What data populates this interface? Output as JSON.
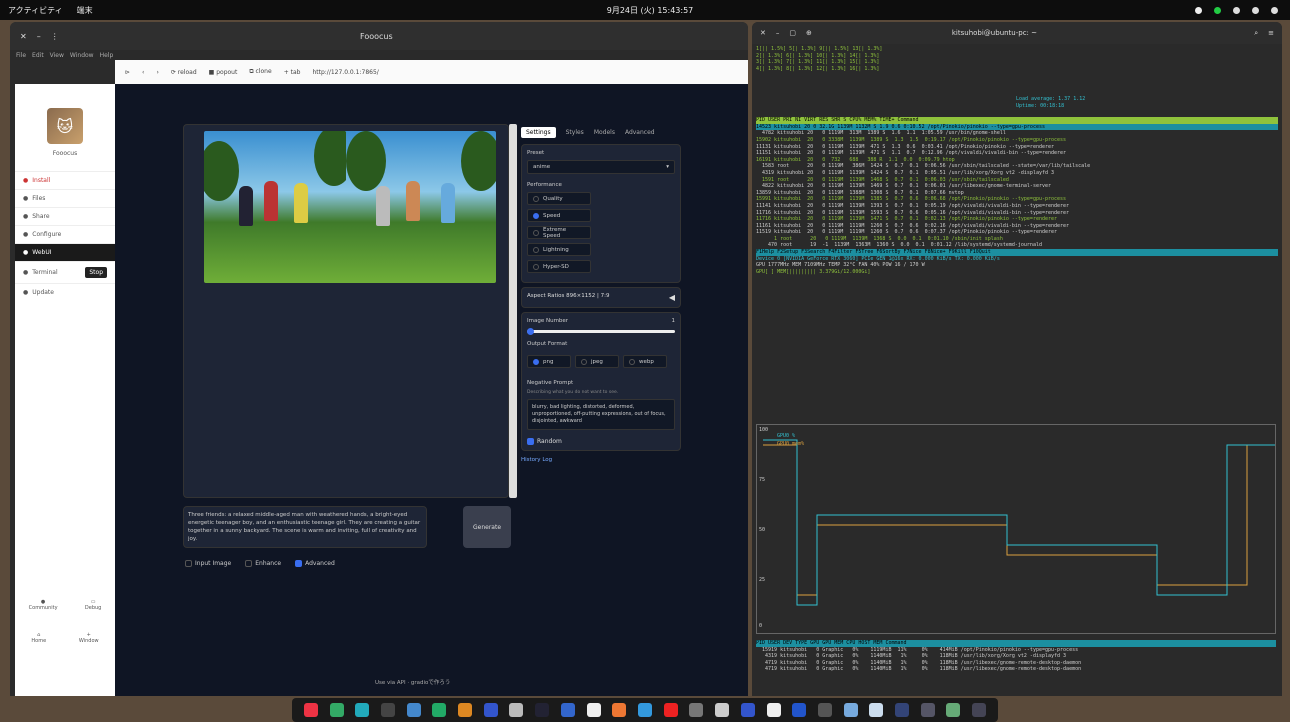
{
  "topbar": {
    "activities": "アクティビティ",
    "app": "端末",
    "clock": "9月24日 (火) 15:43:57"
  },
  "left_window": {
    "title": "Fooocus",
    "menu": [
      "File",
      "Edit",
      "View",
      "Window",
      "Help"
    ]
  },
  "browser": {
    "url": "http://127.0.0.1:7865/",
    "buttons": [
      "reload",
      "popout",
      "clone",
      "tab"
    ]
  },
  "sidebar": {
    "app_name": "Fooocus",
    "items": [
      {
        "label": "Install",
        "cls": "red"
      },
      {
        "label": "Files",
        "cls": ""
      },
      {
        "label": "Share",
        "cls": ""
      },
      {
        "label": "Configure",
        "cls": ""
      },
      {
        "label": "WebUI",
        "cls": "active"
      },
      {
        "label": "Terminal",
        "cls": ""
      },
      {
        "label": "Update",
        "cls": ""
      }
    ],
    "stop_label": "Stop",
    "bottom": [
      "Community",
      "Debug",
      "Home",
      "Window"
    ]
  },
  "ui": {
    "tabs": [
      "Settings",
      "Styles",
      "Models",
      "Advanced"
    ],
    "preset_label": "Preset",
    "preset_value": "anime",
    "performance_label": "Performance",
    "performance_options": [
      {
        "label": "Quality",
        "on": false
      },
      {
        "label": "Speed",
        "on": true
      },
      {
        "label": "Extreme Speed",
        "on": false
      },
      {
        "label": "Lightning",
        "on": false
      },
      {
        "label": "Hyper-SD",
        "on": false
      }
    ],
    "aspect_label": "Aspect Ratios 896×1152 | 7:9",
    "image_number_label": "Image Number",
    "image_number": "1",
    "output_label": "Output Format",
    "output_options": [
      {
        "label": "png",
        "on": true
      },
      {
        "label": "jpeg",
        "on": false
      },
      {
        "label": "webp",
        "on": false
      }
    ],
    "negative_label": "Negative Prompt",
    "negative_hint": "Describing what you do not want to see.",
    "negative_text": "blurry, bad lighting, distorted, deformed, unproportioned, off-putting expressions, out of focus, disjointed, awkward",
    "random_label": "Random",
    "history_link": "History Log",
    "prompt": "Three friends: a relaxed middle-aged man with weathered hands, a bright-eyed energetic teenager boy, and an enthusiastic teenage girl. They are creating a guitar together in a sunny backyard. The scene is warm and inviting, full of creativity and joy.",
    "generate": "Generate",
    "checks": [
      {
        "label": "Input Image",
        "on": false
      },
      {
        "label": "Enhance",
        "on": false
      },
      {
        "label": "Advanced",
        "on": true
      }
    ],
    "footer": "Use via API  ·  gradioで作ろう"
  },
  "terminal": {
    "title": "kitsuhobi@ubuntu-pc: ~",
    "load": "Load average: 1.37 1.12",
    "uptime": "Uptime: 00:18:18",
    "header": "  PID USER      PRI  NI  VIRT   RES   SHR S CPU% MEM%   TIME+  Command",
    "rows": [
      "14523 kitsuhobi  20   0 32.1G  1139M 1132M S  1.9  0.6  0:10.52 /opt/Pinokio/pinokio --type=gpu-process",
      "  4782 kitsuhobi 20   0 1119M  313M  1389 S  1.6  1.1  1:05.59 /usr/bin/gnome-shell",
      "15902 kitsuhobi  20   0 3338M  1139M  1389 S  1.3  1.5  0:19.17 /opt/Pinokio/pinokio --type=gpu-process",
      "11131 kitsuhobi  20   0 1119M  1139M  471 S  1.3  0.6  0:03.41 /opt/Pinokio/pinokio --type=renderer",
      "11151 kitsuhobi  20   0 1119M  1139M  471 S  1.1  0.7  0:12.96 /opt/vivaldi/vivaldi-bin --type=renderer",
      "16191 kitsuhobi  20   0  732   688   388 R  1.1  0.0  0:09.79 htop",
      "  1583 root      20   0 1119M   386M  1424 S  0.7  0.1  0:06.56 /usr/sbin/tailscaled --state=/var/lib/tailscale",
      "  4319 kitsuhobi 20   0 1119M  1139M  1424 S  0.7  0.1  0:05.51 /usr/lib/xorg/Xorg vt2 -displayfd 3",
      "  1591 root      20   0 1119M  1139M  1468 S  0.7  0.1  0:06.03 /usr/sbin/tailscaled",
      "  4822 kitsuhobi 20   0 1119M  1139M  1469 S  0.7  0.1  0:06.01 /usr/libexec/gnome-terminal-server",
      "13859 kitsuhobi  20   0 1119M  1388M  1308 S  0.7  0.1  0:07.66 nvtop",
      "15991 kitsuhobi  20   0 1119M  1139M  1385 S  0.7  0.6  0:06.68 /opt/Pinokio/pinokio --type=gpu-process",
      "11141 kitsuhobi  20   0 1119M  1139M  1393 S  0.7  0.1  0:05.19 /opt/vivaldi/vivaldi-bin --type=renderer",
      "11716 kitsuhobi  20   0 1119M  1139M  1593 S  0.7  0.6  0:05.16 /opt/vivaldi/vivaldi-bin --type=renderer",
      "11716 kitsuhobi  20   0 1119M  1139M  1471 S  0.7  0.1  0:02.13 /opt/Pinokio/pinokio --type=renderer",
      "11161 kitsuhobi  20   0 1119M  1119M  1260 S  0.7  0.6  0:02.16 /opt/vivaldi/vivaldi-bin --type=renderer",
      "11519 kitsuhobi  20   0 1119M  1119M  1260 S  0.7  0.6  0:07.37 /opt/Pinokio/pinokio --type=renderer",
      "      1 root      20   0 1119M  1139M  1368 S  0.0  0.1  0:01.10 /sbin/init splash",
      "    470 root      19  -1  1139M  1363M  1360 S  0.0  0.1  0:01.12 /lib/systemd/systemd-journald"
    ],
    "fnkeys": "F1Help  F2Setup  F3Search  F4Filter  F5Tree  F6SortBy  F7Nice  F8Nice+  F9Kill  F10Quit",
    "gpu_line": "Device 0 [NVIDIA GeForce RTX 3060] PCIe GEN 1@16x RX: 0.000 KiB/s TX: 0.000 KiB/s",
    "gpu_line2": "GPU 1777MHz MEM 7109MHz TEMP 32°C FAN 40% POW 16 / 170 W",
    "gpu_line3": "GPU[                    ]  MEM[|||||||||     3.379Gi/12.000Gi]",
    "graph_labels": [
      "100",
      "75",
      "50",
      "25",
      "0"
    ],
    "graph_legend": [
      "GPU0 %",
      "GPU0 mem%"
    ],
    "proc_header": "    PID   USER DEV    TYPE  GPU        GPU MEM    CPU  HOST MEM Command",
    "proc_rows": [
      "  15919 kitsuhobi   0 Graphic   0%    1119MiB  11%     0%    414MiB /opt/Pinokio/pinokio --type=gpu-process",
      "   4319 kitsuhobi   0 Graphic   0%    1140MiB   1%     0%    118MiB /usr/lib/xorg/Xorg vt2 -displayfd 3",
      "   4719 kitsuhobi   0 Graphic   0%    1140MiB   1%     0%    118MiB /usr/libexec/gnome-remote-desktop-daemon",
      "   4719 kitsuhobi   0 Graphic   0%    1140MiB   1%     0%    118MiB /usr/libexec/gnome-remote-desktop-daemon"
    ]
  },
  "taskbar": {
    "colors": [
      "#e34",
      "#3a6",
      "#2ab",
      "#444",
      "#48c",
      "#2a6",
      "#d82",
      "#35c",
      "#bbb",
      "#223",
      "#36c",
      "#eee",
      "#e73",
      "#39d",
      "#e22",
      "#777",
      "#ccc",
      "#35c",
      "#eee",
      "#25c",
      "#555",
      "#7ad",
      "#cde",
      "#347",
      "#556",
      "#6a7",
      "#445"
    ]
  }
}
